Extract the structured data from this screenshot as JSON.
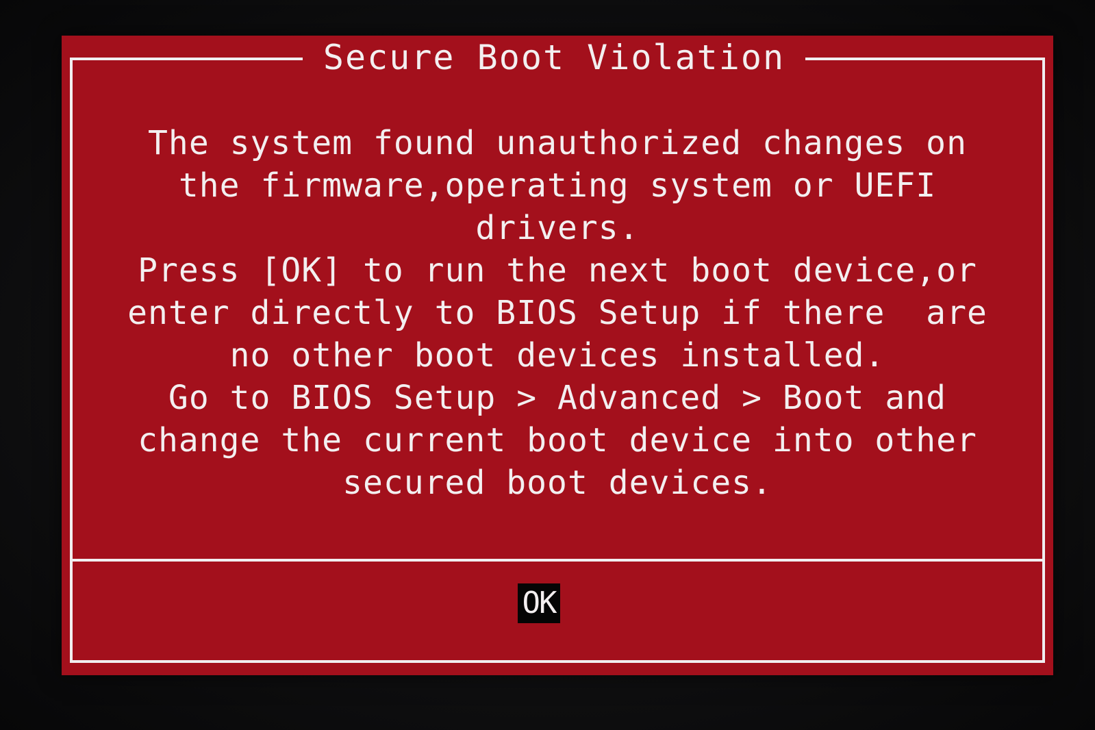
{
  "dialog": {
    "title": "Secure Boot Violation",
    "message_lines": [
      "The system found unauthorized changes on",
      "the firmware,operating system or UEFI",
      "drivers.",
      "Press [OK] to run the next boot device,or",
      "enter directly to BIOS Setup if there  are",
      "no other boot devices installed.",
      "Go to BIOS Setup > Advanced > Boot and",
      "change the current boot device into other",
      "secured boot devices."
    ],
    "ok_label": "OK",
    "colors": {
      "background": "#a3101c",
      "text": "#f3eff0",
      "border": "#f1eef0",
      "button_background": "#050505",
      "screen": "#0b0b0c"
    }
  }
}
